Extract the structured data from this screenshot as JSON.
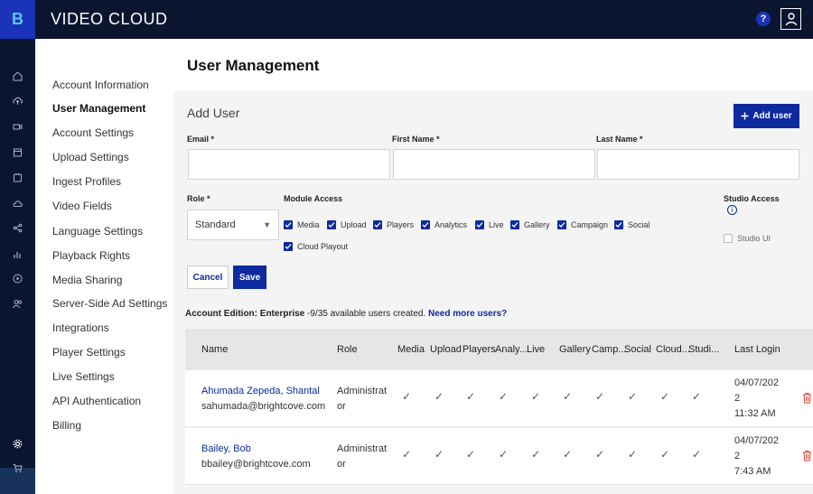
{
  "app": {
    "logo_letter": "B",
    "brand": "VIDEO CLOUD",
    "help_label": "?",
    "colors": {
      "topbar": "#0b1530",
      "accent": "#0d2a9e",
      "logo_bg": "#1a33b8",
      "logo_fg": "#5ac8f5",
      "delete": "#d64030"
    }
  },
  "rail": {
    "icons": [
      "home-icon",
      "upload-icon",
      "video-icon",
      "calendar-icon",
      "folder-icon",
      "cloud-icon",
      "share-icon",
      "analytics-icon",
      "play-icon",
      "users-icon",
      "gear-icon",
      "cart-icon"
    ],
    "active": "gear-icon"
  },
  "nav": {
    "items": [
      "Account Information",
      "User Management",
      "Account Settings",
      "Upload Settings",
      "Ingest Profiles",
      "Video Fields",
      "Language Settings",
      "Playback Rights",
      "Media Sharing",
      "Server-Side Ad Settings",
      "Integrations",
      "Player Settings",
      "Live Settings",
      "API Authentication",
      "Billing"
    ],
    "active": "User Management"
  },
  "page": {
    "title": "User Management"
  },
  "add_user": {
    "title": "Add User",
    "add_button": "Add user",
    "email_label": "Email *",
    "first_name_label": "First Name *",
    "last_name_label": "Last Name *",
    "role_label": "Role *",
    "role_value": "Standard",
    "module_access_label": "Module Access",
    "modules": [
      "Media",
      "Upload",
      "Players",
      "Analytics",
      "Live",
      "Gallery",
      "Campaign",
      "Social",
      "Cloud Playout"
    ],
    "studio_access_label": "Studio Access",
    "studio_ui_label": "Studio UI",
    "cancel_label": "Cancel",
    "save_label": "Save"
  },
  "edition": {
    "prefix": "Account Edition: ",
    "edition_name": "Enterprise",
    "count_text": " -9/35 available users created. ",
    "link": "Need more users?"
  },
  "table": {
    "headers": [
      "Name",
      "Role",
      "Media",
      "Upload",
      "Players",
      "Analy...",
      "Live",
      "Gallery",
      "Camp...",
      "Social",
      "Cloud...",
      "Studi...",
      "Last Login"
    ],
    "rows": [
      {
        "name": "Ahumada Zepeda, Shantal",
        "email": "sahumada@brightcove.com",
        "role_line1": "Administrat",
        "role_line2": "or",
        "checks": [
          "✓",
          "✓",
          "✓",
          "✓",
          "✓",
          "✓",
          "✓",
          "✓",
          "✓",
          "✓"
        ],
        "login_line1": "04/07/202",
        "login_line2": "2",
        "login_line3": "11:32 AM"
      },
      {
        "name": "Bailey, Bob",
        "email": "bbailey@brightcove.com",
        "role_line1": "Administrat",
        "role_line2": "or",
        "checks": [
          "✓",
          "✓",
          "✓",
          "✓",
          "✓",
          "✓",
          "✓",
          "✓",
          "✓",
          "✓"
        ],
        "login_line1": "04/07/202",
        "login_line2": "2",
        "login_line3": "7:43 AM"
      }
    ]
  }
}
